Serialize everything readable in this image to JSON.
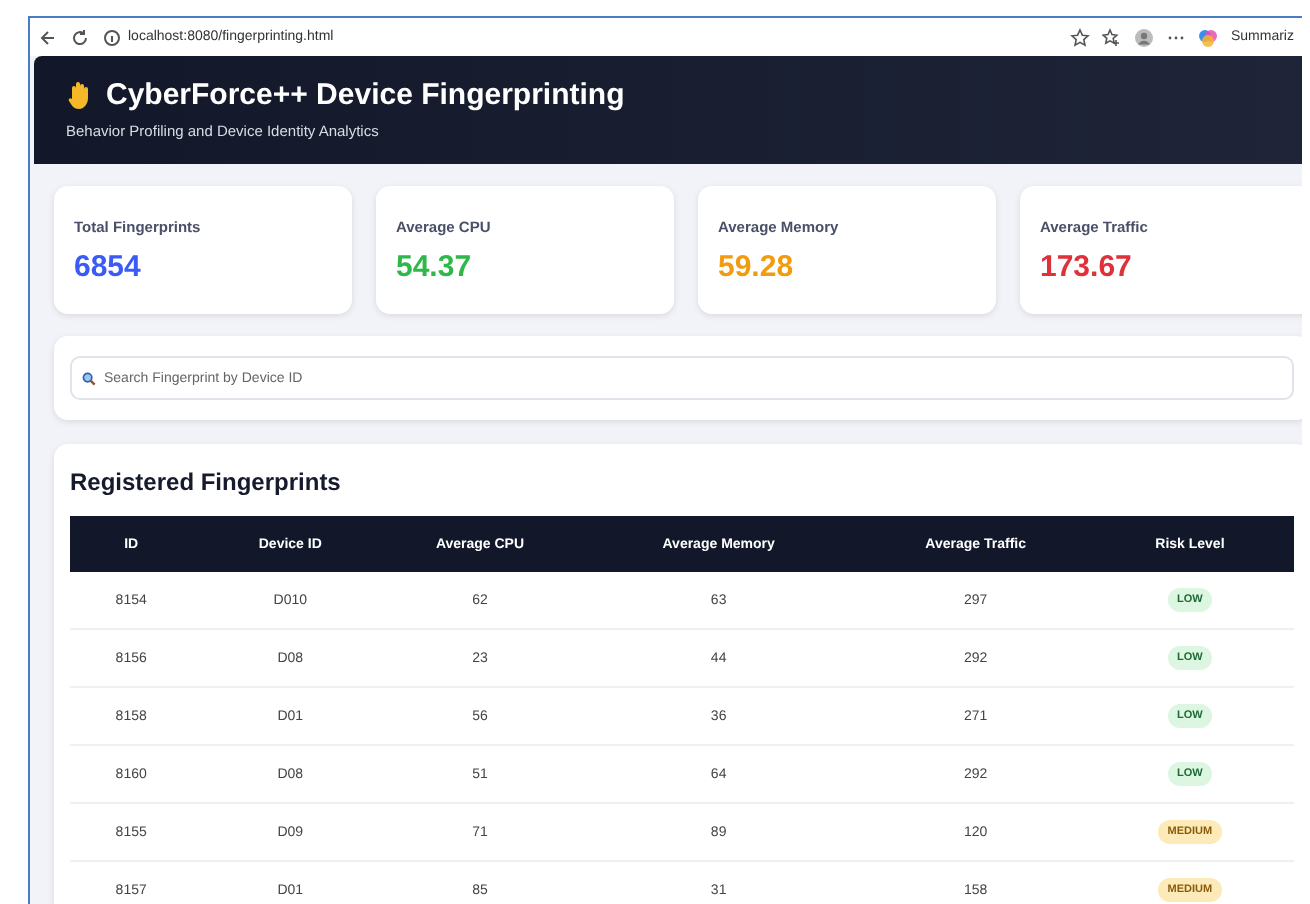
{
  "browser": {
    "url": "localhost:8080/fingerprinting.html",
    "sidebar_button": "Summariz"
  },
  "header": {
    "title": "CyberForce++ Device Fingerprinting",
    "subtitle": "Behavior Profiling and Device Identity Analytics"
  },
  "stats": [
    {
      "label": "Total Fingerprints",
      "value": "6854",
      "color": "#3b5bf5"
    },
    {
      "label": "Average CPU",
      "value": "54.37",
      "color": "#2fb84a"
    },
    {
      "label": "Average Memory",
      "value": "59.28",
      "color": "#f29b0c"
    },
    {
      "label": "Average Traffic",
      "value": "173.67",
      "color": "#e0303a"
    }
  ],
  "search": {
    "placeholder": "Search Fingerprint by Device ID"
  },
  "table": {
    "title": "Registered Fingerprints",
    "columns": [
      "ID",
      "Device ID",
      "Average CPU",
      "Average Memory",
      "Average Traffic",
      "Risk Level"
    ],
    "rows": [
      {
        "cells": [
          "8154",
          "D010",
          "62",
          "63",
          "297"
        ],
        "risk": "LOW",
        "kind": "low"
      },
      {
        "cells": [
          "8156",
          "D08",
          "23",
          "44",
          "292"
        ],
        "risk": "LOW",
        "kind": "low"
      },
      {
        "cells": [
          "8158",
          "D01",
          "56",
          "36",
          "271"
        ],
        "risk": "LOW",
        "kind": "low"
      },
      {
        "cells": [
          "8160",
          "D08",
          "51",
          "64",
          "292"
        ],
        "risk": "LOW",
        "kind": "low"
      },
      {
        "cells": [
          "8155",
          "D09",
          "71",
          "89",
          "120"
        ],
        "risk": "MEDIUM",
        "kind": "medium"
      },
      {
        "cells": [
          "8157",
          "D01",
          "85",
          "31",
          "158"
        ],
        "risk": "MEDIUM",
        "kind": "medium"
      }
    ]
  }
}
